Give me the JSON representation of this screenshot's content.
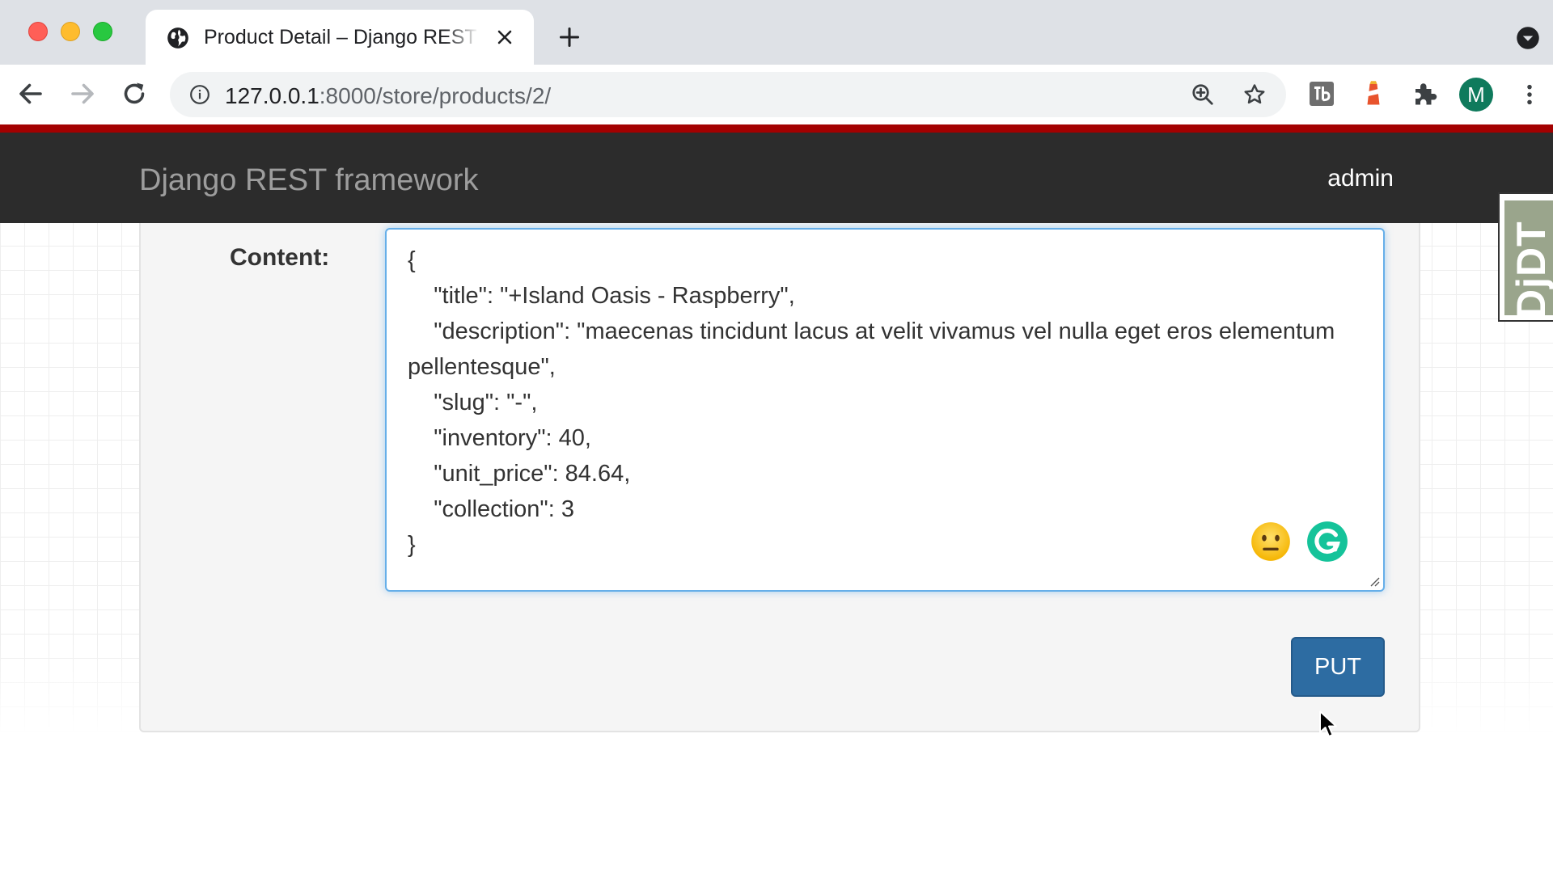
{
  "browser": {
    "tab_title": "Product Detail – Django REST framework",
    "url_host": "127.0.0.1",
    "url_rest": ":8000/store/products/2/",
    "profile_initial": "M"
  },
  "icons": {
    "tab": "globe-icon",
    "tab_close": "close-icon",
    "new_tab": "plus-icon",
    "back": "back-arrow-icon",
    "forward": "forward-arrow-icon",
    "reload": "reload-icon",
    "site_info": "info-icon",
    "zoom": "zoom-in-icon",
    "bookmark": "star-icon",
    "extensions": [
      "tb-extension-icon",
      "lighthouse-extension-icon",
      "puzzle-extensions-icon"
    ],
    "menu": "three-dots-menu-icon",
    "emoji": "neutral-face-emoji-icon",
    "grammarly": "grammarly-icon"
  },
  "page": {
    "brand": "Django REST framework",
    "user": "admin",
    "content_label": "Content:",
    "content_value": "{\n    \"title\": \"+Island Oasis - Raspberry\",\n    \"description\": \"maecenas tincidunt lacus at velit vivamus vel nulla eget eros elementum pellentesque\",\n    \"slug\": \"-\",\n    \"inventory\": 40,\n    \"unit_price\": 84.64,\n    \"collection\": 3\n}",
    "put_button": "PUT",
    "debug_toolbar_label": "DjDT"
  },
  "colors": {
    "accent_stripe": "#a30000",
    "navbar": "#2c2c2c",
    "primary_button": "#2d6ca2",
    "focus_border": "#66afe9"
  }
}
